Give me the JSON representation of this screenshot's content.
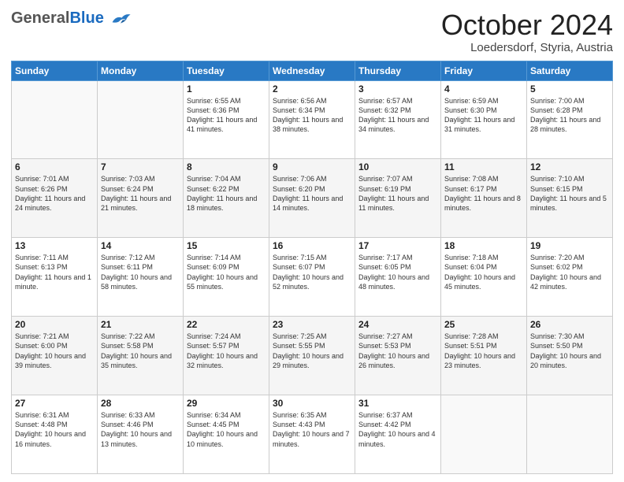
{
  "header": {
    "logo_line1": "General",
    "logo_line2": "Blue",
    "month": "October 2024",
    "location": "Loedersdorf, Styria, Austria"
  },
  "days_of_week": [
    "Sunday",
    "Monday",
    "Tuesday",
    "Wednesday",
    "Thursday",
    "Friday",
    "Saturday"
  ],
  "weeks": [
    [
      {
        "day": "",
        "empty": true
      },
      {
        "day": "",
        "empty": true
      },
      {
        "day": "1",
        "sunrise": "6:55 AM",
        "sunset": "6:36 PM",
        "daylight": "11 hours and 41 minutes."
      },
      {
        "day": "2",
        "sunrise": "6:56 AM",
        "sunset": "6:34 PM",
        "daylight": "11 hours and 38 minutes."
      },
      {
        "day": "3",
        "sunrise": "6:57 AM",
        "sunset": "6:32 PM",
        "daylight": "11 hours and 34 minutes."
      },
      {
        "day": "4",
        "sunrise": "6:59 AM",
        "sunset": "6:30 PM",
        "daylight": "11 hours and 31 minutes."
      },
      {
        "day": "5",
        "sunrise": "7:00 AM",
        "sunset": "6:28 PM",
        "daylight": "11 hours and 28 minutes."
      }
    ],
    [
      {
        "day": "6",
        "sunrise": "7:01 AM",
        "sunset": "6:26 PM",
        "daylight": "11 hours and 24 minutes."
      },
      {
        "day": "7",
        "sunrise": "7:03 AM",
        "sunset": "6:24 PM",
        "daylight": "11 hours and 21 minutes."
      },
      {
        "day": "8",
        "sunrise": "7:04 AM",
        "sunset": "6:22 PM",
        "daylight": "11 hours and 18 minutes."
      },
      {
        "day": "9",
        "sunrise": "7:06 AM",
        "sunset": "6:20 PM",
        "daylight": "11 hours and 14 minutes."
      },
      {
        "day": "10",
        "sunrise": "7:07 AM",
        "sunset": "6:19 PM",
        "daylight": "11 hours and 11 minutes."
      },
      {
        "day": "11",
        "sunrise": "7:08 AM",
        "sunset": "6:17 PM",
        "daylight": "11 hours and 8 minutes."
      },
      {
        "day": "12",
        "sunrise": "7:10 AM",
        "sunset": "6:15 PM",
        "daylight": "11 hours and 5 minutes."
      }
    ],
    [
      {
        "day": "13",
        "sunrise": "7:11 AM",
        "sunset": "6:13 PM",
        "daylight": "11 hours and 1 minute."
      },
      {
        "day": "14",
        "sunrise": "7:12 AM",
        "sunset": "6:11 PM",
        "daylight": "10 hours and 58 minutes."
      },
      {
        "day": "15",
        "sunrise": "7:14 AM",
        "sunset": "6:09 PM",
        "daylight": "10 hours and 55 minutes."
      },
      {
        "day": "16",
        "sunrise": "7:15 AM",
        "sunset": "6:07 PM",
        "daylight": "10 hours and 52 minutes."
      },
      {
        "day": "17",
        "sunrise": "7:17 AM",
        "sunset": "6:05 PM",
        "daylight": "10 hours and 48 minutes."
      },
      {
        "day": "18",
        "sunrise": "7:18 AM",
        "sunset": "6:04 PM",
        "daylight": "10 hours and 45 minutes."
      },
      {
        "day": "19",
        "sunrise": "7:20 AM",
        "sunset": "6:02 PM",
        "daylight": "10 hours and 42 minutes."
      }
    ],
    [
      {
        "day": "20",
        "sunrise": "7:21 AM",
        "sunset": "6:00 PM",
        "daylight": "10 hours and 39 minutes."
      },
      {
        "day": "21",
        "sunrise": "7:22 AM",
        "sunset": "5:58 PM",
        "daylight": "10 hours and 35 minutes."
      },
      {
        "day": "22",
        "sunrise": "7:24 AM",
        "sunset": "5:57 PM",
        "daylight": "10 hours and 32 minutes."
      },
      {
        "day": "23",
        "sunrise": "7:25 AM",
        "sunset": "5:55 PM",
        "daylight": "10 hours and 29 minutes."
      },
      {
        "day": "24",
        "sunrise": "7:27 AM",
        "sunset": "5:53 PM",
        "daylight": "10 hours and 26 minutes."
      },
      {
        "day": "25",
        "sunrise": "7:28 AM",
        "sunset": "5:51 PM",
        "daylight": "10 hours and 23 minutes."
      },
      {
        "day": "26",
        "sunrise": "7:30 AM",
        "sunset": "5:50 PM",
        "daylight": "10 hours and 20 minutes."
      }
    ],
    [
      {
        "day": "27",
        "sunrise": "6:31 AM",
        "sunset": "4:48 PM",
        "daylight": "10 hours and 16 minutes."
      },
      {
        "day": "28",
        "sunrise": "6:33 AM",
        "sunset": "4:46 PM",
        "daylight": "10 hours and 13 minutes."
      },
      {
        "day": "29",
        "sunrise": "6:34 AM",
        "sunset": "4:45 PM",
        "daylight": "10 hours and 10 minutes."
      },
      {
        "day": "30",
        "sunrise": "6:35 AM",
        "sunset": "4:43 PM",
        "daylight": "10 hours and 7 minutes."
      },
      {
        "day": "31",
        "sunrise": "6:37 AM",
        "sunset": "4:42 PM",
        "daylight": "10 hours and 4 minutes."
      },
      {
        "day": "",
        "empty": true
      },
      {
        "day": "",
        "empty": true
      }
    ]
  ]
}
